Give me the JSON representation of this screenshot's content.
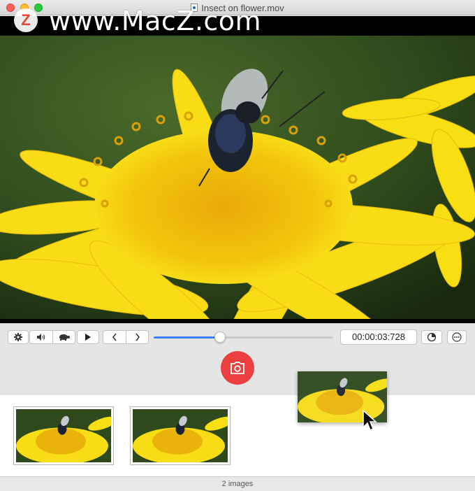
{
  "window": {
    "title": "Insect on flower.mov"
  },
  "watermark": {
    "logo_letter": "Z",
    "text": "www.MacZ.com"
  },
  "toolbar": {
    "settings_icon": "gear-icon",
    "volume_icon": "speaker-icon",
    "speed_icon": "turtle-icon",
    "play_icon": "play-icon",
    "prev_icon": "chevron-left-icon",
    "next_icon": "chevron-right-icon",
    "timecode": "00:00:03:728",
    "progress": 0.37,
    "interval_icon": "timer-icon",
    "more_icon": "ellipsis-icon"
  },
  "capture": {
    "icon": "camera-icon",
    "color": "#ec4040"
  },
  "gallery": {
    "images_count": 2
  },
  "status": {
    "text": "2 images"
  },
  "colors": {
    "accent": "#3b82f6",
    "flower": "#f5d90a",
    "background_green": "#2e4a1c"
  }
}
